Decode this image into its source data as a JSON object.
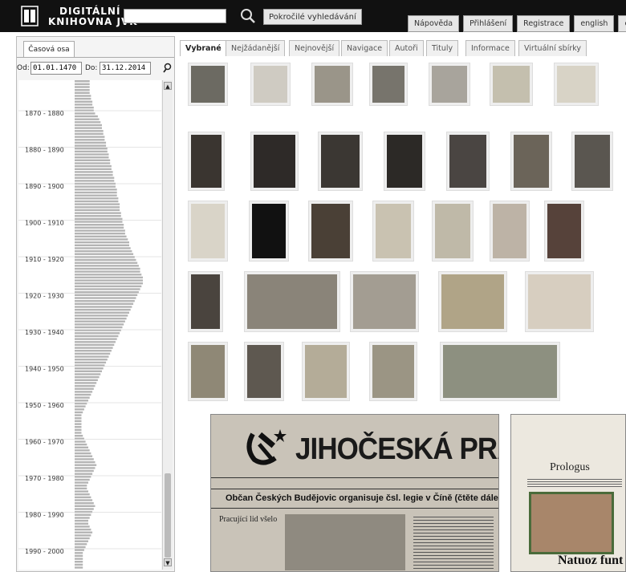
{
  "header": {
    "logo_line1": "DIGITÁLNÍ",
    "logo_line2": "KNIHOVNA JVK",
    "search_value": "",
    "advanced_search_label": "Pokročilé vyhledávání",
    "nav": [
      "Nápověda",
      "Přihlášení",
      "Registrace",
      "english",
      "česky"
    ]
  },
  "timeline_panel": {
    "tab_label": "Časová osa",
    "from_label": "Od:",
    "from_value": "01.01.1470",
    "to_label": "Do:",
    "to_value": "31.12.2014",
    "decade_labels": [
      "1870 - 1880",
      "1880 - 1890",
      "1890 - 1900",
      "1900 - 1910",
      "1910 - 1920",
      "1920 - 1930",
      "1930 - 1940",
      "1940 - 1950",
      "1950 - 1960",
      "1960 - 1970",
      "1970 - 1980",
      "1980 - 1990",
      "1990 - 2000"
    ],
    "bar_lengths": [
      22,
      22,
      22,
      22,
      22,
      24,
      24,
      26,
      26,
      28,
      28,
      30,
      34,
      36,
      38,
      40,
      40,
      42,
      42,
      44,
      44,
      46,
      46,
      48,
      48,
      50,
      50,
      52,
      52,
      54,
      54,
      56,
      56,
      58,
      58,
      60,
      60,
      62,
      62,
      62,
      64,
      64,
      66,
      66,
      66,
      68,
      68,
      70,
      70,
      72,
      72,
      74,
      74,
      76,
      78,
      80,
      80,
      82,
      84,
      86,
      88,
      90,
      92,
      94,
      96,
      96,
      98,
      100,
      100,
      100,
      98,
      96,
      94,
      92,
      90,
      88,
      86,
      84,
      82,
      80,
      78,
      76,
      74,
      72,
      70,
      68,
      66,
      64,
      62,
      60,
      58,
      56,
      54,
      52,
      50,
      48,
      46,
      44,
      42,
      40,
      38,
      36,
      34,
      32,
      30,
      28,
      26,
      24,
      22,
      20,
      18,
      16,
      14,
      12,
      10,
      10,
      10,
      10,
      10,
      10,
      10,
      12,
      14,
      16,
      18,
      20,
      22,
      24,
      26,
      28,
      30,
      32,
      30,
      28,
      26,
      24,
      22,
      20,
      18,
      18,
      20,
      22,
      24,
      26,
      28,
      30,
      28,
      26,
      24,
      22,
      20,
      20,
      22,
      24,
      26,
      24,
      22,
      20,
      18,
      16,
      14,
      12,
      12,
      12,
      12,
      12,
      12
    ]
  },
  "tabs": [
    "Vybrané",
    "Nejžádanější",
    "Nejnovější",
    "Navigace",
    "Autoři",
    "Tituly",
    "Informace",
    "Virtuální sbírky"
  ],
  "preview": {
    "title": "JIHOČESKÁ PRAVDA",
    "headline": "Občan Českých Budějovic organisuje čsl. legie v Číně (čtěte dále).",
    "subhead": "Pracující lid všelo",
    "page2_title": "Prologus",
    "page2_footer": "Natuoz funt m"
  },
  "colors": {
    "header_bg": "#111111",
    "panel_bg": "#f4f4f4",
    "bar_color": "#b4b4b4"
  }
}
